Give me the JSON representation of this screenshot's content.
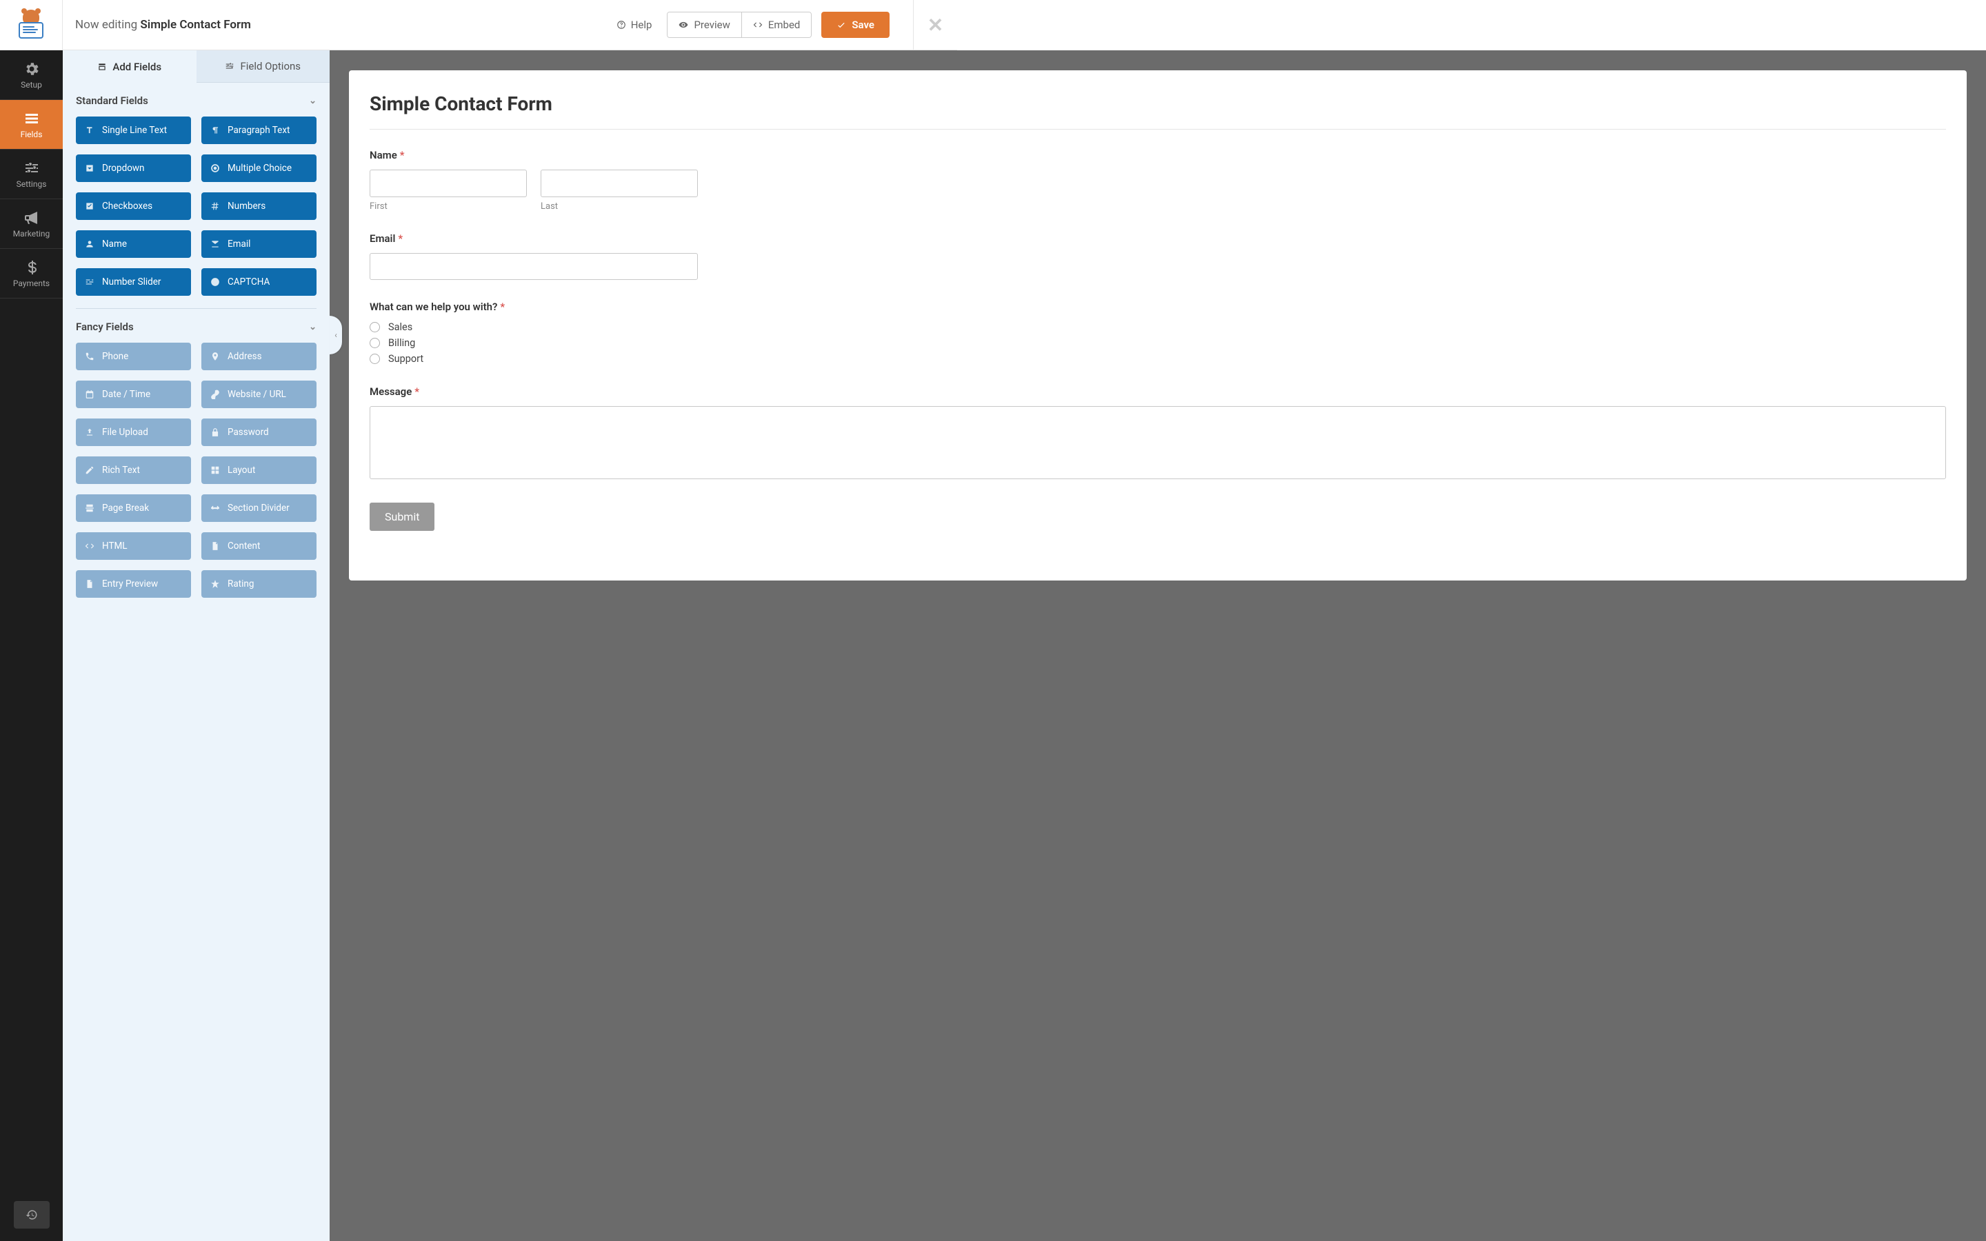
{
  "header": {
    "editing_prefix": "Now editing ",
    "form_name": "Simple Contact Form",
    "help_label": "Help",
    "preview_label": "Preview",
    "embed_label": "Embed",
    "save_label": "Save"
  },
  "left_nav": {
    "items": [
      {
        "label": "Setup"
      },
      {
        "label": "Fields"
      },
      {
        "label": "Settings"
      },
      {
        "label": "Marketing"
      },
      {
        "label": "Payments"
      }
    ]
  },
  "sidebar": {
    "tabs": {
      "add_fields": "Add Fields",
      "field_options": "Field Options"
    },
    "sections": {
      "standard": {
        "title": "Standard Fields",
        "fields": [
          {
            "label": "Single Line Text",
            "icon": "text"
          },
          {
            "label": "Paragraph Text",
            "icon": "paragraph"
          },
          {
            "label": "Dropdown",
            "icon": "dropdown"
          },
          {
            "label": "Multiple Choice",
            "icon": "radio"
          },
          {
            "label": "Checkboxes",
            "icon": "check"
          },
          {
            "label": "Numbers",
            "icon": "hash"
          },
          {
            "label": "Name",
            "icon": "user"
          },
          {
            "label": "Email",
            "icon": "mail"
          },
          {
            "label": "Number Slider",
            "icon": "sliders"
          },
          {
            "label": "CAPTCHA",
            "icon": "question"
          }
        ]
      },
      "fancy": {
        "title": "Fancy Fields",
        "fields": [
          {
            "label": "Phone",
            "icon": "phone"
          },
          {
            "label": "Address",
            "icon": "pin"
          },
          {
            "label": "Date / Time",
            "icon": "calendar"
          },
          {
            "label": "Website / URL",
            "icon": "link"
          },
          {
            "label": "File Upload",
            "icon": "upload"
          },
          {
            "label": "Password",
            "icon": "lock"
          },
          {
            "label": "Rich Text",
            "icon": "edit"
          },
          {
            "label": "Layout",
            "icon": "layout"
          },
          {
            "label": "Page Break",
            "icon": "pagebreak"
          },
          {
            "label": "Section Divider",
            "icon": "divider"
          },
          {
            "label": "HTML",
            "icon": "code"
          },
          {
            "label": "Content",
            "icon": "doc"
          },
          {
            "label": "Entry Preview",
            "icon": "doc"
          },
          {
            "label": "Rating",
            "icon": "star"
          }
        ]
      }
    }
  },
  "preview": {
    "title": "Simple Contact Form",
    "fields": {
      "name": {
        "label": "Name",
        "first_sub": "First",
        "last_sub": "Last"
      },
      "email": {
        "label": "Email"
      },
      "help": {
        "label": "What can we help you with?",
        "options": [
          "Sales",
          "Billing",
          "Support"
        ]
      },
      "message": {
        "label": "Message"
      }
    },
    "submit_label": "Submit"
  }
}
